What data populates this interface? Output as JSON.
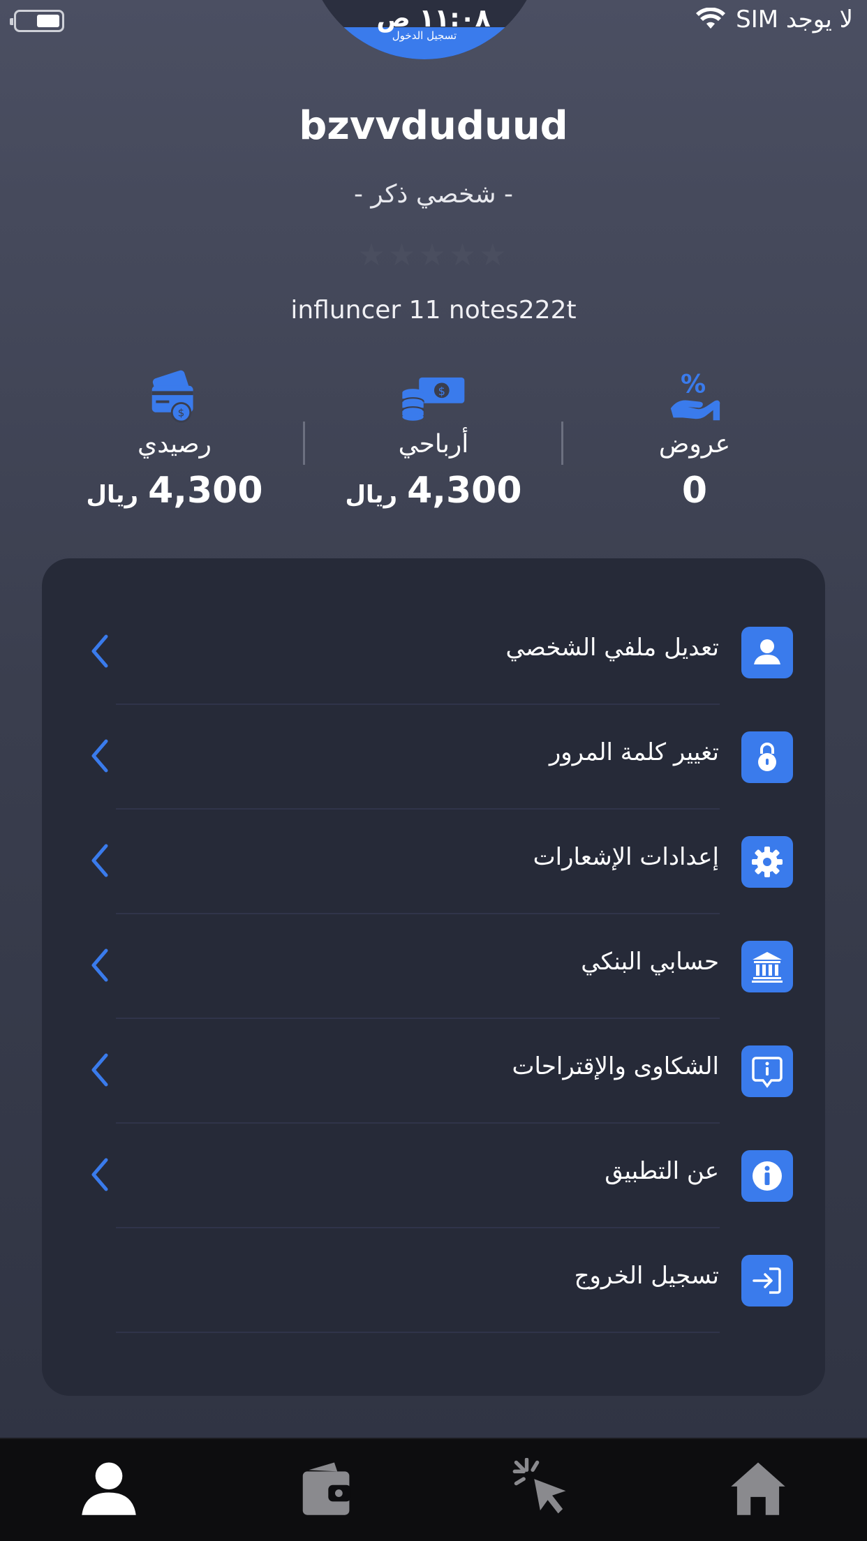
{
  "status_bar": {
    "carrier": "لا يوجد SIM",
    "time": "١١:٠٨ ص"
  },
  "avatar": {
    "band_label": "تسجيل الدخول"
  },
  "profile": {
    "username": "bzvvduduud",
    "subtitle": "- شخصي ذكر -",
    "stars": "★★★★★",
    "rating": 0,
    "notes": "influncer 11 notes222t"
  },
  "stats": [
    {
      "label": "رصيدي",
      "value": "4,300",
      "unit": "ريال",
      "icon": "wallet-card-icon"
    },
    {
      "label": "أرباحي",
      "value": "4,300",
      "unit": "ريال",
      "icon": "money-coins-icon"
    },
    {
      "label": "عروض",
      "value": "0",
      "icon": "discount-hand-icon"
    }
  ],
  "menu": [
    {
      "label": "تعديل ملفي الشخصي",
      "icon": "user-icon"
    },
    {
      "label": "تغيير كلمة المرور",
      "icon": "lock-icon"
    },
    {
      "label": "إعدادات الإشعارات",
      "icon": "gear-icon"
    },
    {
      "label": "حسابي البنكي",
      "icon": "bank-icon"
    },
    {
      "label": "الشكاوى والإقتراحات",
      "icon": "info-bubble-icon"
    },
    {
      "label": "عن التطبيق",
      "icon": "info-icon"
    },
    {
      "label": "تسجيل الخروج",
      "icon": "logout-icon"
    }
  ],
  "bottom_nav": [
    "profile-icon",
    "wallet-icon",
    "click-icon",
    "home-icon"
  ],
  "colors": {
    "accent": "#3a7bec",
    "card": "#262a38",
    "nav": "#0d0d0f"
  }
}
